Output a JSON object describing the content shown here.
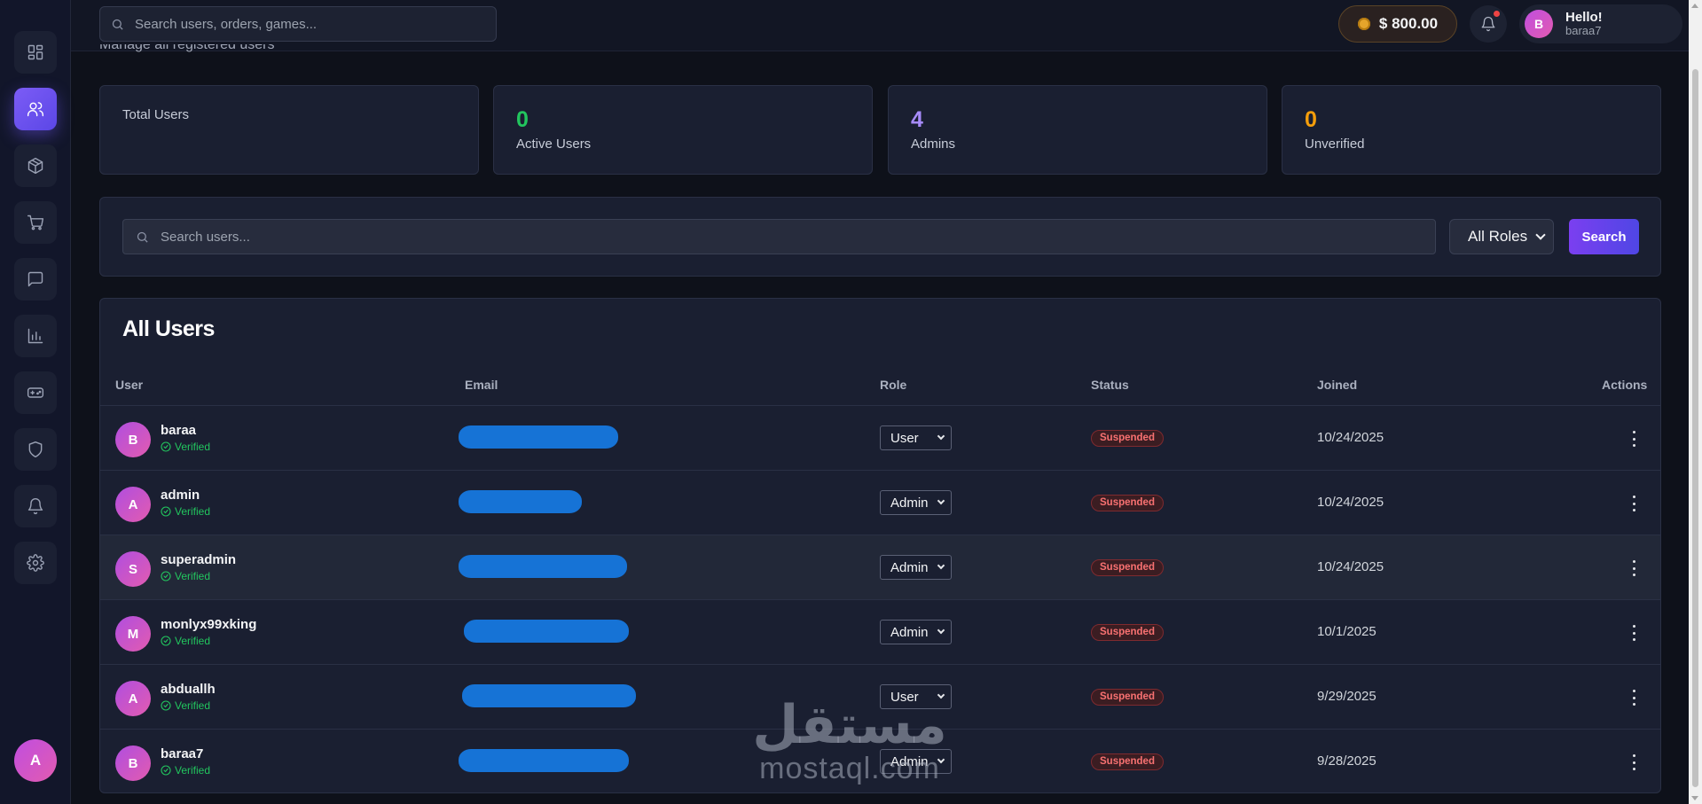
{
  "colors": {
    "accent": "#6d4ff0",
    "active_stat": "#22c55e",
    "admins_stat": "#a78bfa",
    "unverified_stat": "#f59e0b",
    "suspended": "#f87171",
    "verified": "#22c55e"
  },
  "sidebar": {
    "items": [
      {
        "icon": "dashboard-icon",
        "active": false
      },
      {
        "icon": "users-icon",
        "active": true
      },
      {
        "icon": "box-icon",
        "active": false
      },
      {
        "icon": "cart-icon",
        "active": false
      },
      {
        "icon": "chat-icon",
        "active": false
      },
      {
        "icon": "bar-chart-icon",
        "active": false
      },
      {
        "icon": "gamepad-icon",
        "active": false
      },
      {
        "icon": "shield-icon",
        "active": false
      },
      {
        "icon": "bell-icon",
        "active": false
      },
      {
        "icon": "gear-icon",
        "active": false
      }
    ],
    "avatar_initial": "A"
  },
  "topbar": {
    "search_placeholder": "Search users, orders, games...",
    "balance": "$ 800.00",
    "greeting": "Hello!",
    "username": "baraa7",
    "avatar_initial": "B"
  },
  "page": {
    "subtitle": "Manage all registered users"
  },
  "stats": [
    {
      "value": "",
      "label": "Total Users"
    },
    {
      "value": "0",
      "label": "Active Users"
    },
    {
      "value": "4",
      "label": "Admins"
    },
    {
      "value": "0",
      "label": "Unverified"
    }
  ],
  "filters": {
    "search_placeholder": "Search users...",
    "role_selected": "All Roles",
    "search_button": "Search"
  },
  "table": {
    "title": "All Users",
    "headers": {
      "user": "User",
      "email": "Email",
      "role": "Role",
      "status": "Status",
      "joined": "Joined",
      "actions": "Actions"
    },
    "verified_label": "Verified",
    "rows": [
      {
        "initial": "B",
        "name": "baraa",
        "role": "User",
        "status": "Suspended",
        "joined": "10/24/2025"
      },
      {
        "initial": "A",
        "name": "admin",
        "role": "Admin",
        "status": "Suspended",
        "joined": "10/24/2025"
      },
      {
        "initial": "S",
        "name": "superadmin",
        "role": "Admin",
        "status": "Suspended",
        "joined": "10/24/2025"
      },
      {
        "initial": "M",
        "name": "monlyx99xking",
        "role": "Admin",
        "status": "Suspended",
        "joined": "10/1/2025"
      },
      {
        "initial": "A",
        "name": "abduallh",
        "role": "User",
        "status": "Suspended",
        "joined": "9/29/2025"
      },
      {
        "initial": "B",
        "name": "baraa7",
        "role": "Admin",
        "status": "Suspended",
        "joined": "9/28/2025"
      }
    ]
  },
  "watermark": {
    "arabic": "مستقل",
    "latin": "mostaql.com"
  }
}
